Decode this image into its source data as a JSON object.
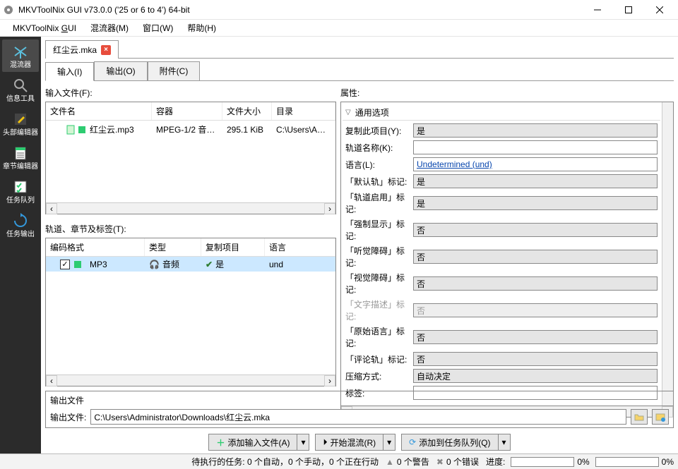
{
  "window": {
    "title": "MKVToolNix GUI v73.0.0 ('25 or 6 to 4') 64-bit"
  },
  "menubar": {
    "app": "MKVToolNix GUI",
    "mux": "混流器(M)",
    "window": "窗口(W)",
    "help": "帮助(H)"
  },
  "sidebar": {
    "items": [
      {
        "label": "混流器"
      },
      {
        "label": "信息工具"
      },
      {
        "label": "头部编辑器"
      },
      {
        "label": "章节编辑器"
      },
      {
        "label": "任务队列"
      },
      {
        "label": "任务输出"
      }
    ]
  },
  "doc_tab": {
    "name": "红尘云.mka"
  },
  "io_tabs": {
    "input": "输入(I)",
    "output": "输出(O)",
    "attachments": "附件(C)"
  },
  "input_files": {
    "label": "输入文件(F):",
    "columns": {
      "name": "文件名",
      "container": "容器",
      "size": "文件大小",
      "dir": "目录"
    },
    "rows": [
      {
        "name": "红尘云.mp3",
        "container": "MPEG-1/2 音…",
        "size": "295.1 KiB",
        "dir": "C:\\Users\\A…"
      }
    ]
  },
  "tracks": {
    "label": "轨道、章节及标签(T):",
    "columns": {
      "codec": "编码格式",
      "type": "类型",
      "copy": "复制项目",
      "lang": "语言"
    },
    "rows": [
      {
        "codec": "MP3",
        "type": "音频",
        "copy": "是",
        "lang": "und",
        "checked": true
      }
    ]
  },
  "properties": {
    "label": "属性:",
    "group": "通用选项",
    "rows": {
      "copy": {
        "label": "复制此项目(Y):",
        "value": "是"
      },
      "track_name": {
        "label": "轨道名称(K):",
        "value": ""
      },
      "language": {
        "label": "语言(L):",
        "value": "Undetermined (und)"
      },
      "default": {
        "label": "「默认轨」标记:",
        "value": "是"
      },
      "enabled": {
        "label": "「轨道启用」标记:",
        "value": "是"
      },
      "forced": {
        "label": "「强制显示」标记:",
        "value": "否"
      },
      "hearing": {
        "label": "「听觉障碍」标记:",
        "value": "否"
      },
      "visual": {
        "label": "「视觉障碍」标记:",
        "value": "否"
      },
      "text_desc": {
        "label": "「文字描述」标记:",
        "value": "否"
      },
      "original": {
        "label": "「原始语言」标记:",
        "value": "否"
      },
      "commentary": {
        "label": "「评论轨」标记:",
        "value": "否"
      },
      "compression": {
        "label": "压缩方式:",
        "value": "自动决定"
      },
      "tags": {
        "label": "标签:",
        "value": ""
      }
    }
  },
  "output": {
    "section": "输出文件",
    "label": "输出文件:",
    "path": "C:\\Users\\Administrator\\Downloads\\红尘云.mka"
  },
  "actions": {
    "add": "添加输入文件(A)",
    "start": "开始混流(R)",
    "queue": "添加到任务队列(Q)"
  },
  "status": {
    "pending": "待执行的任务: 0 个自动，0 个手动，0 个正在行动",
    "warnings": "0 个警告",
    "errors": "0 个错误",
    "progress_label": "进度:",
    "progress_value": "0%",
    "progress_value2": "0%"
  }
}
